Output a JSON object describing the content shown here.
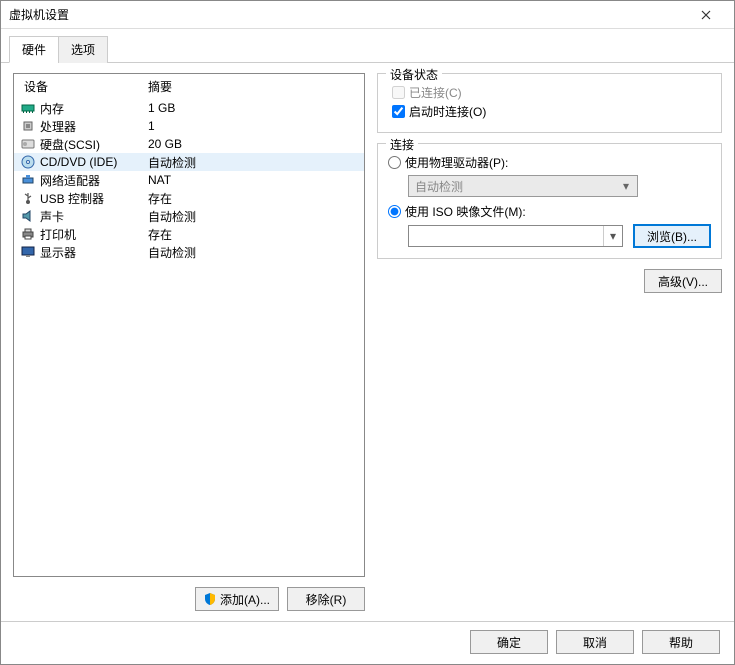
{
  "window": {
    "title": "虚拟机设置"
  },
  "tabs": {
    "hardware": "硬件",
    "options": "选项"
  },
  "hw": {
    "col_device": "设备",
    "col_summary": "摘要",
    "rows": [
      {
        "name": "内存",
        "summary": "1 GB",
        "icon": "memory-icon"
      },
      {
        "name": "处理器",
        "summary": "1",
        "icon": "cpu-icon"
      },
      {
        "name": "硬盘(SCSI)",
        "summary": "20 GB",
        "icon": "hdd-icon"
      },
      {
        "name": "CD/DVD (IDE)",
        "summary": "自动检测",
        "icon": "cd-icon",
        "selected": true
      },
      {
        "name": "网络适配器",
        "summary": "NAT",
        "icon": "net-icon"
      },
      {
        "name": "USB 控制器",
        "summary": "存在",
        "icon": "usb-icon"
      },
      {
        "name": "声卡",
        "summary": "自动检测",
        "icon": "sound-icon"
      },
      {
        "name": "打印机",
        "summary": "存在",
        "icon": "printer-icon"
      },
      {
        "name": "显示器",
        "summary": "自动检测",
        "icon": "display-icon"
      }
    ],
    "add_btn": "添加(A)...",
    "remove_btn": "移除(R)"
  },
  "status": {
    "legend": "设备状态",
    "connected_label": "已连接(C)",
    "connect_at_power_label": "启动时连接(O)",
    "connected_checked": false,
    "connect_at_power_checked": true
  },
  "conn": {
    "legend": "连接",
    "use_physical_label": "使用物理驱动器(P):",
    "physical_combo_value": "自动检测",
    "use_iso_label": "使用 ISO 映像文件(M):",
    "iso_value": "",
    "browse_btn": "浏览(B)...",
    "selected": "iso"
  },
  "advanced_btn": "高级(V)...",
  "buttons": {
    "ok": "确定",
    "cancel": "取消",
    "help": "帮助"
  }
}
